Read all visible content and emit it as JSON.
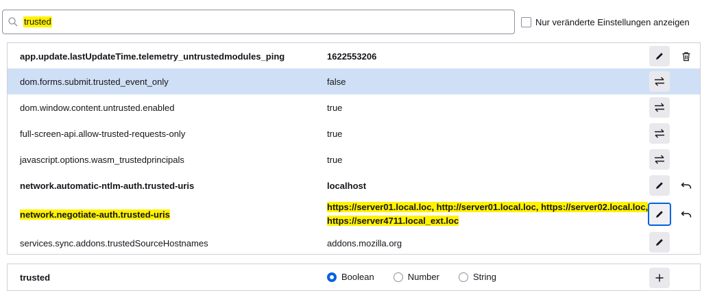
{
  "search": {
    "value": "trusted"
  },
  "modified_only": {
    "label": "Nur veränderte Einstellungen anzeigen",
    "checked": false
  },
  "prefs": [
    {
      "name": "app.update.lastUpdateTime.telemetry_untrustedmodules_ping",
      "value": "1622553206",
      "modified": true,
      "action": "edit-icon",
      "secondary": "delete-icon"
    },
    {
      "name": "dom.forms.submit.trusted_event_only",
      "value": "false",
      "modified": false,
      "action": "toggle-icon"
    },
    {
      "name": "dom.window.content.untrusted.enabled",
      "value": "true",
      "modified": false,
      "action": "toggle-icon"
    },
    {
      "name": "full-screen-api.allow-trusted-requests-only",
      "value": "true",
      "modified": false,
      "action": "toggle-icon"
    },
    {
      "name": "javascript.options.wasm_trustedprincipals",
      "value": "true",
      "modified": false,
      "action": "toggle-icon"
    },
    {
      "name": "network.automatic-ntlm-auth.trusted-uris",
      "value": "localhost",
      "modified": true,
      "action": "edit-icon",
      "secondary": "reset-icon"
    },
    {
      "name": "network.negotiate-auth.trusted-uris",
      "value": "https://server01.local.loc, http://server01.local.loc, https://server02.local.loc, https://server4711.local_ext.loc",
      "modified": true,
      "action": "edit-icon",
      "secondary": "reset-icon"
    },
    {
      "name": "services.sync.addons.trustedSourceHostnames",
      "value": "addons.mozilla.org",
      "modified": false,
      "action": "edit-icon"
    }
  ],
  "new_pref": {
    "name": "trusted",
    "types": [
      "Boolean",
      "Number",
      "String"
    ],
    "selected_type": "Boolean"
  },
  "colors": {
    "accent": "#0061e0",
    "selected_row": "#cfe0f6",
    "highlight": "#fff200"
  }
}
